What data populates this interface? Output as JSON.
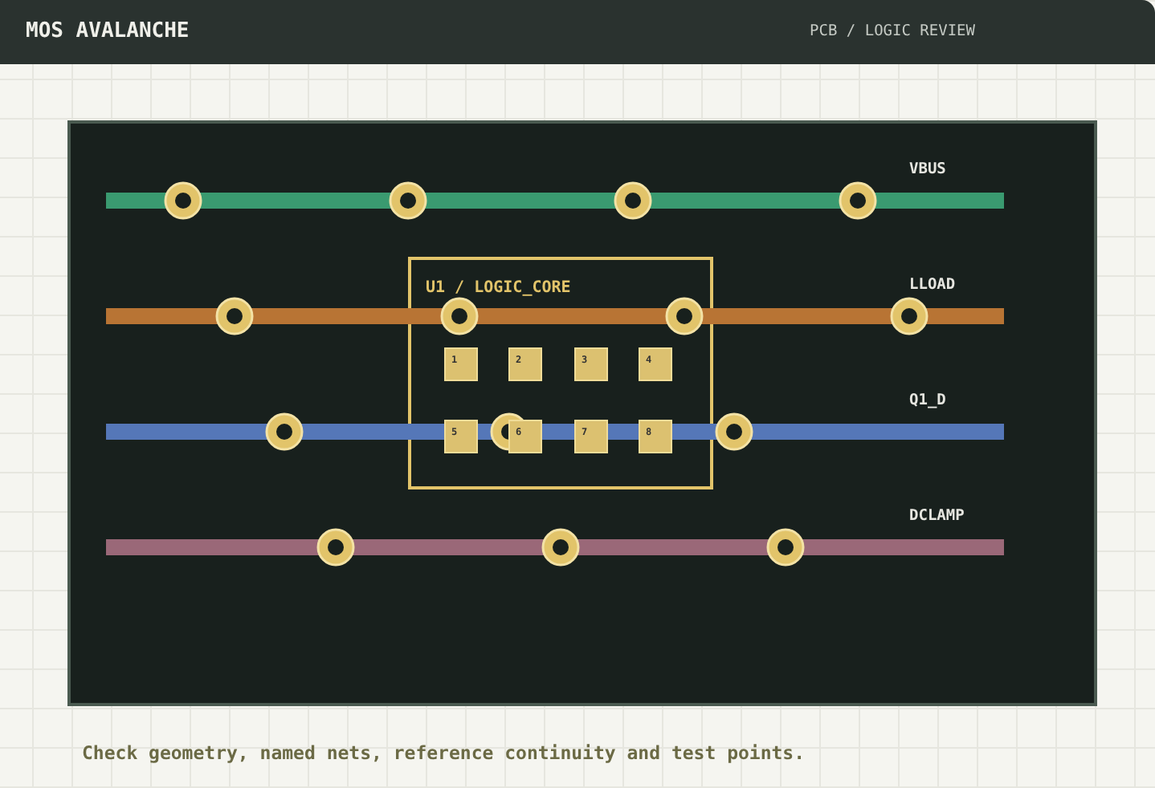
{
  "header": {
    "title": "MOS AVALANCHE",
    "breadcrumb": "PCB / LOGIC REVIEW"
  },
  "board": {
    "nets": [
      {
        "name": "VBUS",
        "color": "#3a9a70"
      },
      {
        "name": "LLOAD",
        "color": "#b87434"
      },
      {
        "name": "Q1_D",
        "color": "#5577b8"
      },
      {
        "name": "DCLAMP",
        "color": "#9a6878"
      }
    ],
    "component": {
      "label": "U1 / LOGIC_CORE",
      "pins": [
        "1",
        "2",
        "3",
        "4",
        "5",
        "6",
        "7",
        "8"
      ]
    }
  },
  "footer": "Check geometry, named nets, reference continuity and test points."
}
